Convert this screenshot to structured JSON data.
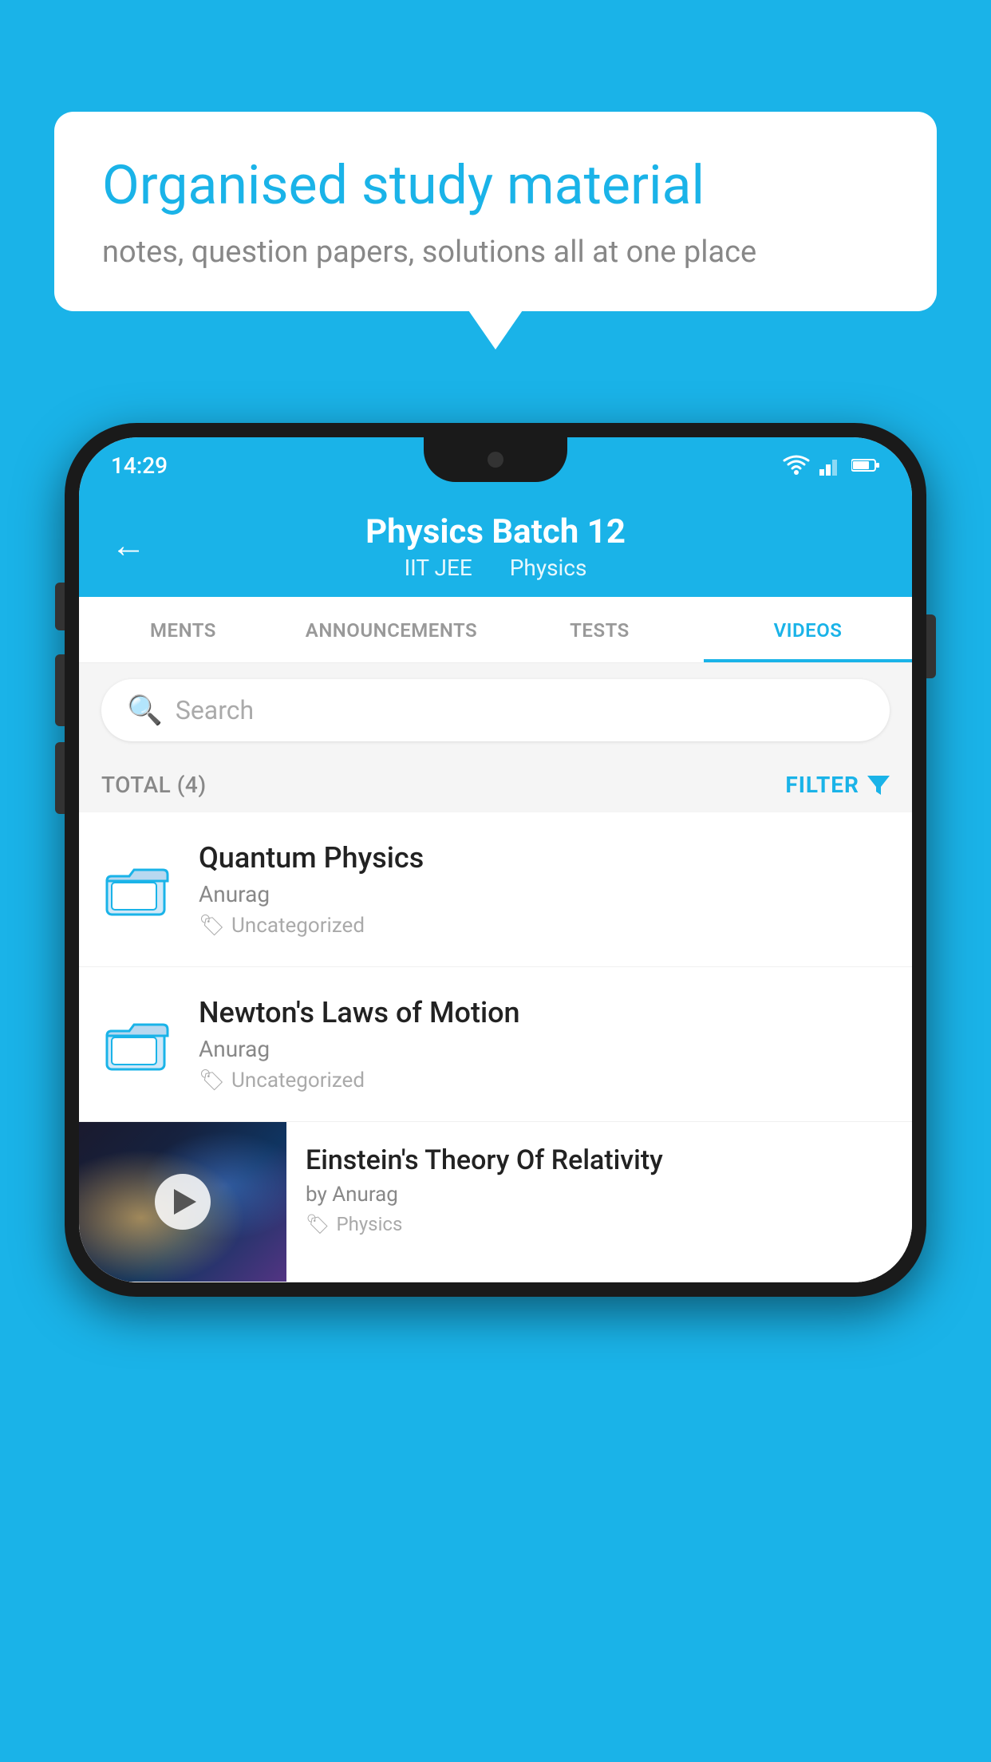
{
  "background_color": "#1ab3e8",
  "bubble": {
    "title": "Organised study material",
    "subtitle": "notes, question papers, solutions all at one place"
  },
  "phone": {
    "status_bar": {
      "time": "14:29",
      "icons": [
        "wifi",
        "signal",
        "battery"
      ]
    },
    "header": {
      "back_label": "←",
      "title": "Physics Batch 12",
      "subtitle_tag1": "IIT JEE",
      "subtitle_tag2": "Physics"
    },
    "tabs": [
      {
        "label": "MENTS",
        "active": false
      },
      {
        "label": "ANNOUNCEMENTS",
        "active": false
      },
      {
        "label": "TESTS",
        "active": false
      },
      {
        "label": "VIDEOS",
        "active": true
      }
    ],
    "search": {
      "placeholder": "Search"
    },
    "filter_bar": {
      "total_label": "TOTAL (4)",
      "filter_label": "FILTER"
    },
    "items": [
      {
        "type": "folder",
        "title": "Quantum Physics",
        "author": "Anurag",
        "tag": "Uncategorized"
      },
      {
        "type": "folder",
        "title": "Newton's Laws of Motion",
        "author": "Anurag",
        "tag": "Uncategorized"
      },
      {
        "type": "video",
        "title": "Einstein's Theory Of Relativity",
        "author": "by Anurag",
        "tag": "Physics"
      }
    ]
  }
}
